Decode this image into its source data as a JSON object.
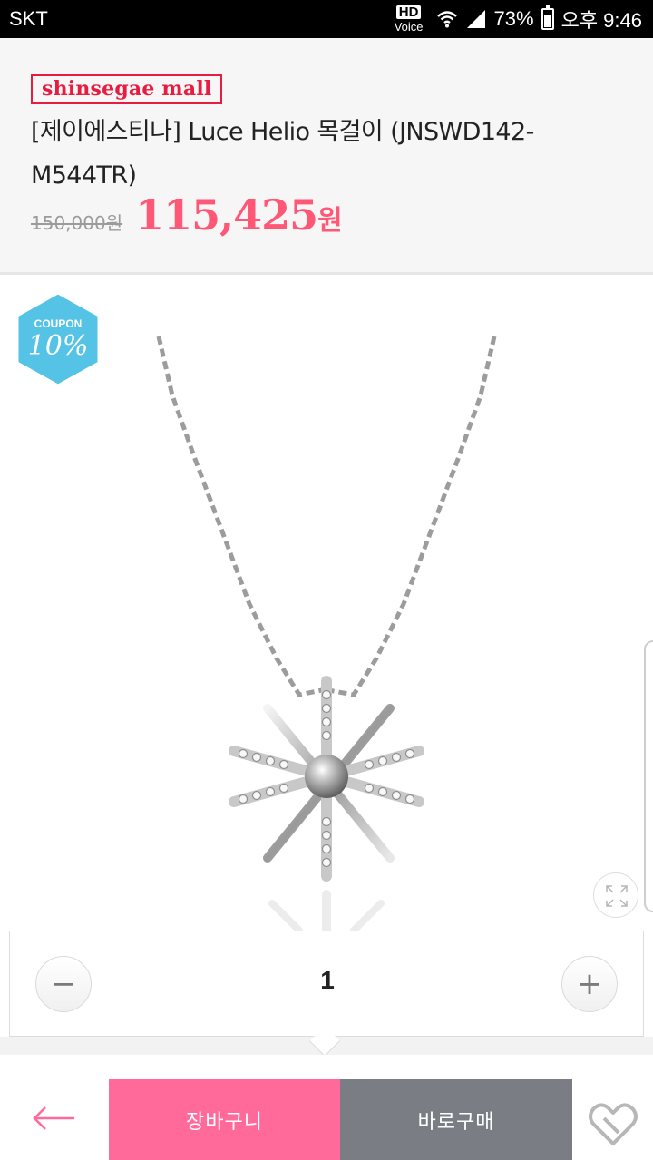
{
  "status_bar": {
    "carrier": "SKT",
    "hd_label": "HD",
    "voice_label": "Voice",
    "battery_percent": "73%",
    "time": "오후 9:46",
    "icons": [
      "wifi-icon",
      "signal-icon",
      "battery-icon"
    ]
  },
  "product": {
    "brand": "shinsegae mall",
    "title": "[제이에스티나] Luce Helio 목걸이 (JNSWD142-M544TR)",
    "original_price": "150,000원",
    "sale_price": "115,425",
    "sale_unit": "원"
  },
  "coupon": {
    "label": "COUPON",
    "value": "10%"
  },
  "image": {
    "icons": [
      "expand-icon"
    ]
  },
  "quantity": {
    "value": "1",
    "minus_symbol": "−",
    "plus_symbol": "+"
  },
  "actions": {
    "cart_label": "장바구니",
    "buy_label": "바로구매",
    "icons": [
      "back-arrow-icon",
      "heart-icon"
    ]
  },
  "colors": {
    "accent_pink": "#ff5776",
    "cart_pink": "#ff6a9b",
    "buy_gray": "#7a7d84",
    "brand_red": "#e61c41",
    "coupon_blue": "#54c3e6"
  }
}
